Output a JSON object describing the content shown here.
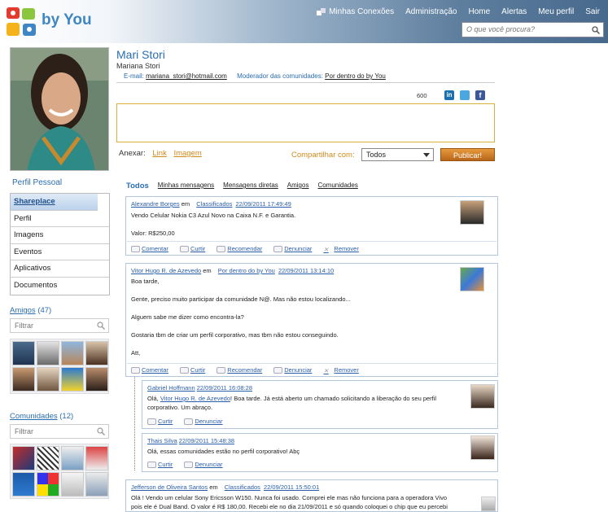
{
  "header": {
    "logo_text": "by You",
    "nav": [
      "Minhas Conexões",
      "Administração",
      "Home",
      "Alertas",
      "Meu perfil",
      "Sair"
    ],
    "search_placeholder": "O que você procura?"
  },
  "profile": {
    "name": "Mari Stori",
    "full_name": "Mariana Stori",
    "email_label": "E-mail:",
    "email": "mariana_stori@hotmail.com",
    "moderator_label": "Moderador das comunidades:",
    "moderator_value": "Por dentro do by You",
    "char_count": "600"
  },
  "composer": {
    "attach_label": "Anexar:",
    "link_label": "Link",
    "image_label": "Imagem",
    "share_label": "Compartilhar com:",
    "share_value": "Todos",
    "publish_label": "Publicar!"
  },
  "sidebar": {
    "profile_title": "Perfil Pessoal",
    "menu": [
      "Shareplace",
      "Perfil",
      "Imagens",
      "Eventos",
      "Aplicativos",
      "Documentos"
    ],
    "friends_label": "Amigos",
    "friends_count": "(47)",
    "filter_placeholder": "Filtrar",
    "communities_label": "Comunidades",
    "communities_count": "(12)"
  },
  "tabs": [
    "Todos",
    "Minhas mensagens",
    "Mensagens diretas",
    "Amigos",
    "Comunidades"
  ],
  "actions": {
    "comment": "Comentar",
    "like": "Curtir",
    "recommend": "Recomendar",
    "report": "Denunciar",
    "remove": "Remover"
  },
  "posts": [
    {
      "author": "Alexandre Borges",
      "in": "em",
      "community": "Classificados",
      "date": "22/09/2011 17:49:49",
      "lines": [
        "Vendo Celular Nokia C3 Azul Novo na Caixa N.F. e Garantia.",
        "",
        "Valor: R$250,00"
      ]
    },
    {
      "author": "Vitor Hugo R. de Azevedo",
      "in": "em",
      "community": "Por dentro do by You",
      "date": "22/09/2011 13:14:10",
      "lines": [
        "Boa tarde,",
        "",
        "Gente, preciso muito participar da comunidade N@. Mas não estou localizando...",
        "",
        "Alguem sabe me dizer como encontra-la?",
        "",
        "Gostaria tbm de criar um perfil corporativo, mas tbm não estou conseguindo.",
        "",
        "Att,"
      ]
    },
    {
      "author": "Jefferson de Oliveira Santos",
      "in": "em",
      "community": "Classificados",
      "date": "22/09/2011 15:50:01",
      "lines": [
        "Olá ! Vendo um celular Sony Ericsson W150. Nunca foi usado. Comprei ele mas não funciona para a operadora Vivo",
        "pois ele é Dual Band. O valor é R$ 180,00. Recebi ele no dia 21/09/2011 e só quando coloquei o chip que eu percebi"
      ]
    }
  ],
  "replies": [
    {
      "author": "Gabriel Hoffmann",
      "date": "22/09/2011 16:08:28",
      "prefix": "Olá,",
      "mention": "Vitor Hugo R. de Azevedo",
      "text": "! Boa tarde. Já está aberto um chamado solicitando a liberação do seu perfil",
      "text2": "corporativo. Um abraço."
    },
    {
      "author": "Thais Silva",
      "date": "22/09/2011 15:48:38",
      "text": "Olá, essas comunidades estão no perfil corporativo! Abç"
    }
  ]
}
